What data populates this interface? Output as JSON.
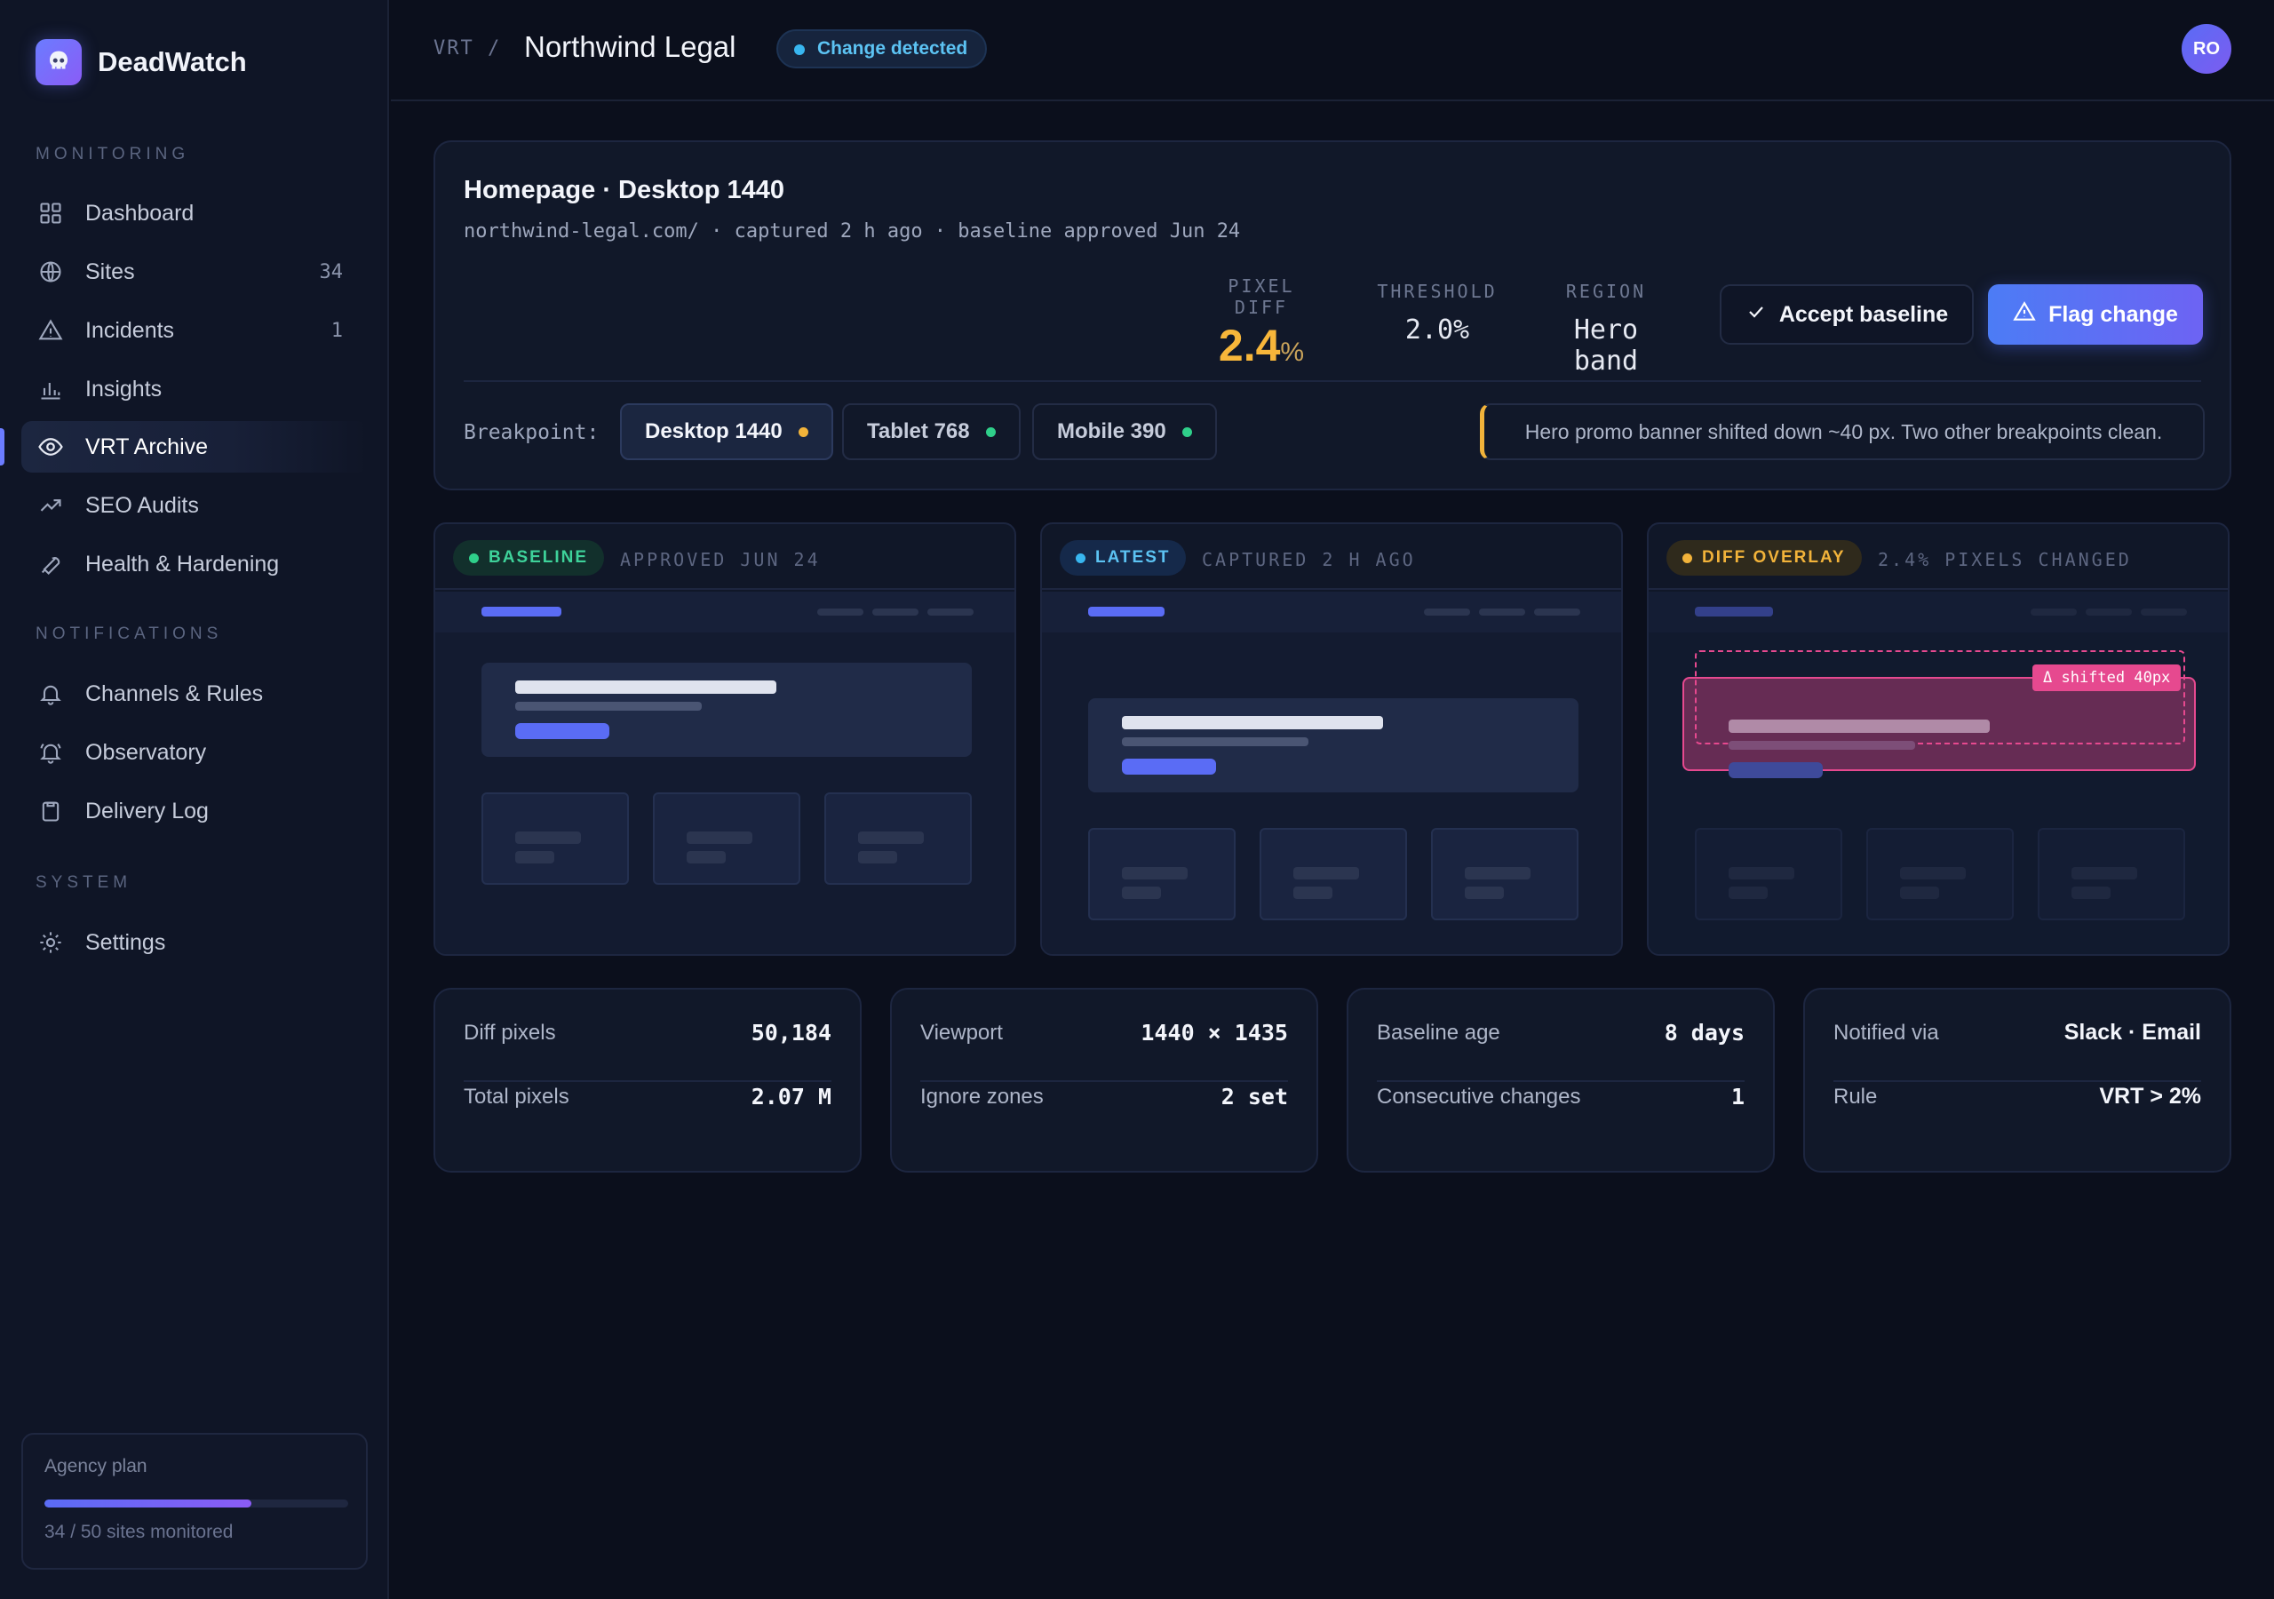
{
  "app": {
    "name": "DeadWatch"
  },
  "sidebar": {
    "sections": {
      "monitoring": "MONITORING",
      "notifications": "NOTIFICATIONS",
      "system": "SYSTEM"
    },
    "items": [
      {
        "label": "Dashboard",
        "icon": "grid-icon"
      },
      {
        "label": "Sites",
        "icon": "globe-icon",
        "count": "34"
      },
      {
        "label": "Incidents",
        "icon": "warning-icon",
        "count": "1"
      },
      {
        "label": "Insights",
        "icon": "bar-chart-icon"
      },
      {
        "label": "VRT Archive",
        "icon": "eye-icon",
        "active": true
      },
      {
        "label": "SEO Audits",
        "icon": "trend-icon"
      },
      {
        "label": "Health & Hardening",
        "icon": "wrench-icon"
      },
      {
        "label": "Channels & Rules",
        "icon": "bell-icon"
      },
      {
        "label": "Observatory",
        "icon": "bell-ring-icon"
      },
      {
        "label": "Delivery Log",
        "icon": "clipboard-icon"
      },
      {
        "label": "Settings",
        "icon": "gear-icon"
      }
    ],
    "plan": {
      "title": "Agency plan",
      "usage_text": "34 / 50 sites monitored",
      "usage_fraction": 0.68
    }
  },
  "topbar": {
    "breadcrumb_root": "VRT /",
    "title": "Northwind Legal",
    "status": "Change detected",
    "avatar_initials": "RO"
  },
  "header": {
    "title": "Homepage · Desktop 1440",
    "subtitle": "northwind-legal.com/ · captured 2 h ago · baseline approved Jun 24",
    "metrics": {
      "pixel_diff_label": "PIXEL DIFF",
      "pixel_diff_value": "2.4",
      "pixel_diff_unit": "%",
      "threshold_label": "THRESHOLD",
      "threshold_value": "2.0%",
      "region_label": "REGION",
      "region_value": "Hero band"
    },
    "accept_label": "Accept baseline",
    "flag_label": "Flag change",
    "breakpoint_label": "Breakpoint:",
    "breakpoints": [
      {
        "label": "Desktop 1440",
        "status_color": "#f2b33a",
        "active": true
      },
      {
        "label": "Tablet 768",
        "status_color": "#2fcf8a"
      },
      {
        "label": "Mobile 390",
        "status_color": "#2fcf8a"
      }
    ],
    "note": "Hero promo banner shifted down ~40 px. Two other breakpoints clean."
  },
  "panels": [
    {
      "tag": "BASELINE",
      "meta": "APPROVED JUN 24"
    },
    {
      "tag": "LATEST",
      "meta": "CAPTURED 2 H AGO"
    },
    {
      "tag": "DIFF OVERLAY",
      "meta": "2.4% PIXELS CHANGED",
      "annotation": "Δ shifted 40px"
    }
  ],
  "stats": [
    {
      "rows": [
        {
          "k": "Diff pixels",
          "v": "50,184"
        },
        {
          "k": "Total pixels",
          "v": "2.07 M"
        }
      ]
    },
    {
      "rows": [
        {
          "k": "Viewport",
          "v": "1440 × 1435"
        },
        {
          "k": "Ignore zones",
          "v": "2 set"
        }
      ]
    },
    {
      "rows": [
        {
          "k": "Baseline age",
          "v": "8 days"
        },
        {
          "k": "Consecutive changes",
          "v": "1"
        }
      ]
    },
    {
      "rows": [
        {
          "k": "Notified via",
          "v": "Slack · Email"
        },
        {
          "k": "Rule",
          "v": "VRT > 2%"
        }
      ]
    }
  ],
  "colors": {
    "accent": "#6b7cff",
    "warning": "#f2b33a",
    "success": "#2fcf8a",
    "info": "#38b6f0",
    "diff": "#e6498f"
  }
}
